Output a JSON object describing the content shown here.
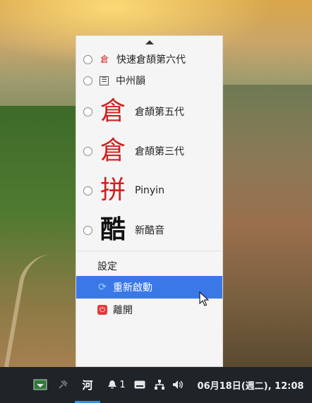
{
  "menu": {
    "items": [
      {
        "label": "快速倉頡第六代",
        "icon": "倉",
        "icon_color": "#cc2a2a"
      },
      {
        "label": "中州韻",
        "icon": "☰",
        "icon_color": "#333333"
      },
      {
        "label": "倉頡第五代",
        "icon": "倉",
        "icon_color": "#d11f1f"
      },
      {
        "label": "倉頡第三代",
        "icon": "倉",
        "icon_color": "#d11f1f"
      },
      {
        "label": "Pinyin",
        "icon": "拼",
        "icon_color": "#d11f1f"
      },
      {
        "label": "新酷音",
        "icon": "酷",
        "icon_color": "#111111"
      }
    ],
    "settings_label": "設定",
    "restart_label": "重新啟動",
    "exit_label": "離開"
  },
  "taskbar": {
    "input_method_char": "河",
    "notification_count": "1",
    "clock": "06月18日(週二), 12:08"
  },
  "colors": {
    "highlight": "#3a78e8",
    "taskbar_bg": "#1f2428",
    "menu_bg": "#f5f5f5",
    "accent_underline": "#3a8edb"
  }
}
